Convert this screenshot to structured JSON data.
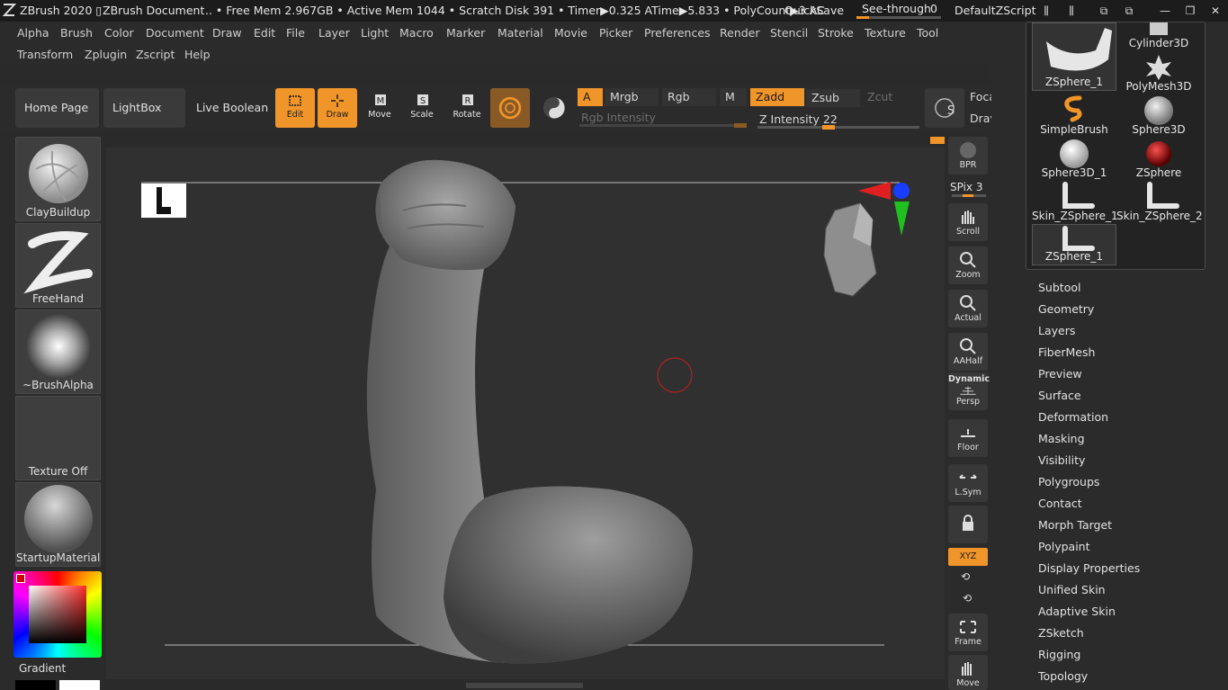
{
  "titlebar": {
    "app": "ZBrush 2020 ▯",
    "document": "ZBrush Document",
    "status": ".. • Free Mem 2.967GB • Active Mem 1044 • Scratch Disk 391 •  Timer▶0.325 ATime▶5.833 • PolyCount▶3  AC",
    "quicksave": "QuickSave",
    "seethrough_label": "See-through",
    "seethrough_value": "0",
    "zscript": "DefaultZScript"
  },
  "menu": {
    "row1": [
      "Alpha",
      "Brush",
      "Color",
      "Document",
      "Draw",
      "Edit",
      "File",
      "Layer",
      "Light",
      "Macro",
      "Marker",
      "Material",
      "Movie",
      "Picker",
      "Preferences",
      "Render",
      "Stencil",
      "Stroke",
      "Texture",
      "Tool"
    ],
    "row2": [
      "Transform",
      "Zplugin",
      "Zscript",
      "Help"
    ]
  },
  "shelf": {
    "home": "Home Page",
    "lightbox": "LightBox",
    "live_boolean": "Live Boolean",
    "edit": "Edit",
    "draw": "Draw",
    "move": "Move",
    "scale": "Scale",
    "rotate": "Rotate",
    "a": "A",
    "mrgb": "Mrgb",
    "rgb": "Rgb",
    "m": "M",
    "zadd": "Zadd",
    "zsub": "Zsub",
    "zcut": "Zcut",
    "rgb_intensity": "Rgb Intensity",
    "z_intensity": "Z Intensity 22",
    "focal": "Foca",
    "draw_size": "Drav"
  },
  "left": {
    "brush": "ClayBuildup",
    "stroke": "FreeHand",
    "alpha": "~BrushAlpha",
    "texture": "Texture Off",
    "material": "StartupMaterial",
    "gradient": "Gradient"
  },
  "rightstrip": {
    "bpr": "BPR",
    "spix": "SPix 3",
    "scroll": "Scroll",
    "zoom": "Zoom",
    "actual": "Actual",
    "aahalf": "AAHalf",
    "dynamic": "Dynamic",
    "persp": "Persp",
    "floor": "Floor",
    "lsym": "L.Sym",
    "xyz": "XYZ",
    "frame": "Frame",
    "move": "Move"
  },
  "toolgrid": {
    "items": [
      "ZSphere_1",
      "Cylinder3D",
      "PolyMesh3D",
      "SimpleBrush",
      "Sphere3D",
      "Sphere3D_1",
      "ZSphere",
      "Skin_ZSphere_1",
      "Skin_ZSphere_2",
      "ZSphere_1"
    ]
  },
  "toolmenu": [
    "Subtool",
    "Geometry",
    "Layers",
    "FiberMesh",
    "Preview",
    "Surface",
    "Deformation",
    "Masking",
    "Visibility",
    "Polygroups",
    "Contact",
    "Morph Target",
    "Polypaint",
    "Display Properties",
    "Unified Skin",
    "Adaptive Skin",
    "ZSketch",
    "Rigging",
    "Topology"
  ],
  "colors": {
    "accent": "#f0952a",
    "bg": "#2a2a2a",
    "canvas": "#303030"
  }
}
